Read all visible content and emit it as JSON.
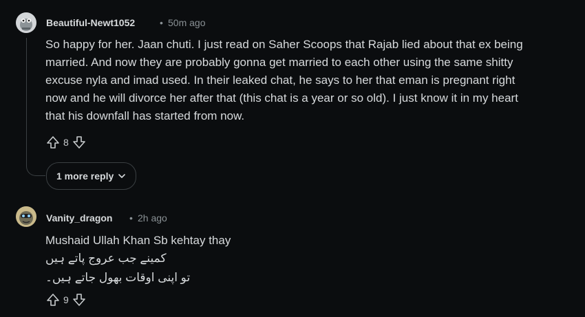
{
  "comments": [
    {
      "username": "Beautiful-Newt1052",
      "separator": "•",
      "time": "50m ago",
      "lines": [
        "So happy for her. Jaan chuti. I just read on Saher Scoops that Rajab lied about that ex being",
        "married. And now they are probably gonna get married to each other using the same shitty",
        "excuse nyla and imad used. In their leaked chat, he says to her that eman is pregnant right",
        "now and he will divorce her after that (this chat is a year or so old). I just know it in my heart",
        "that his downfall has started from now."
      ],
      "score": "8",
      "more_replies_label": "1 more reply"
    },
    {
      "username": "Vanity_dragon",
      "separator": "•",
      "time": "2h ago",
      "lines": [
        "Mushaid Ullah Khan Sb kehtay thay",
        "کمینے جب عروج پاتے ہیں",
        "تو اپنی اوقات بھول جاتے ہیں۔"
      ],
      "score": "9"
    }
  ],
  "icons": {
    "upvote": "arrow-up-outline",
    "downvote": "arrow-down-outline",
    "chevron": "chevron-down"
  }
}
